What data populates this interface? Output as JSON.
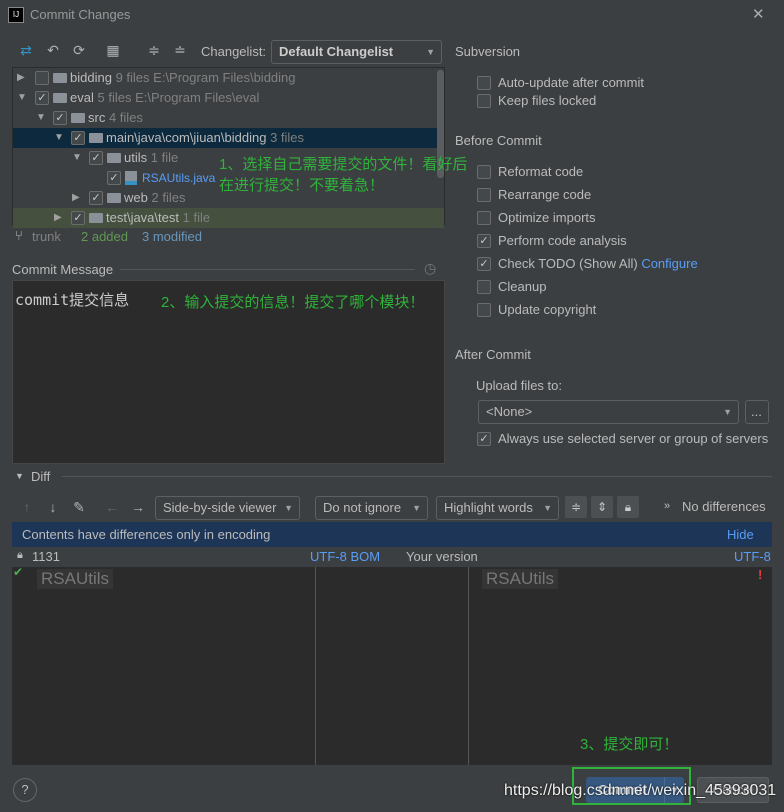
{
  "window": {
    "title": "Commit Changes",
    "close": "✕"
  },
  "toolbar": {
    "changelist_label": "Changelist:",
    "changelist_value": "Default Changelist"
  },
  "tree": [
    {
      "name": "bidding",
      "count": "9 files",
      "path": "E:\\Program Files\\bidding",
      "checked": false
    },
    {
      "name": "eval",
      "count": "5 files",
      "path": "E:\\Program Files\\eval",
      "checked": true
    },
    {
      "name": "src",
      "count": "4 files"
    },
    {
      "name": "main\\java\\com\\jiuan\\bidding",
      "count": "3 files"
    },
    {
      "name": "utils",
      "count": "1 file"
    },
    {
      "name": "RSAUtils.java"
    },
    {
      "name": "web",
      "count": "2 files"
    },
    {
      "name": "test\\java\\test",
      "count": "1 file"
    }
  ],
  "annotations": {
    "step1_line1": "1、选择自己需要提交的文件！看好后",
    "step1_line2": "在进行提交！不要着急！",
    "step2": "2、输入提交的信息！提交了哪个模块！",
    "step3": "3、提交即可！"
  },
  "status": {
    "branch": "trunk",
    "added": "2 added",
    "modified": "3 modified"
  },
  "commit_message": {
    "label": "Commit Message",
    "value": "commit提交信息"
  },
  "subversion": {
    "title": "Subversion",
    "options": [
      {
        "label": "Auto-update after commit",
        "checked": false
      },
      {
        "label": "Keep files locked",
        "checked": false
      }
    ]
  },
  "before_commit": {
    "title": "Before Commit",
    "options": [
      {
        "label": "Reformat code",
        "checked": false
      },
      {
        "label": "Rearrange code",
        "checked": false
      },
      {
        "label": "Optimize imports",
        "checked": false
      },
      {
        "label": "Perform code analysis",
        "checked": true
      },
      {
        "label": "Check TODO (Show All)",
        "checked": true,
        "link": "Configure"
      },
      {
        "label": "Cleanup",
        "checked": false
      },
      {
        "label": "Update copyright",
        "checked": false
      }
    ]
  },
  "after_commit": {
    "title": "After Commit",
    "upload_label": "Upload files to:",
    "upload_value": "<None>",
    "browse": "...",
    "always_use": "Always use selected server or group of servers"
  },
  "diff": {
    "title": "Diff",
    "viewer": "Side-by-side viewer",
    "ignore": "Do not ignore",
    "highlight": "Highlight words",
    "no_diff": "No differences",
    "banner": "Contents have differences only in encoding",
    "hide": "Hide",
    "left_rev": "1131",
    "left_enc": "UTF-8 BOM",
    "right_title": "Your version",
    "right_enc": "UTF-8",
    "left_text": "RSAUtils",
    "right_text": "RSAUtils"
  },
  "buttons": {
    "help": "?",
    "commit": "Commit",
    "cancel": "Cancel"
  },
  "watermark": "https://blog.csdn.net/weixin_45393031",
  "colors": {
    "bg": "#3c3f41",
    "selection": "#0d293e",
    "annotation": "#2fb33a",
    "link": "#589df6",
    "banner": "#1d3557"
  }
}
